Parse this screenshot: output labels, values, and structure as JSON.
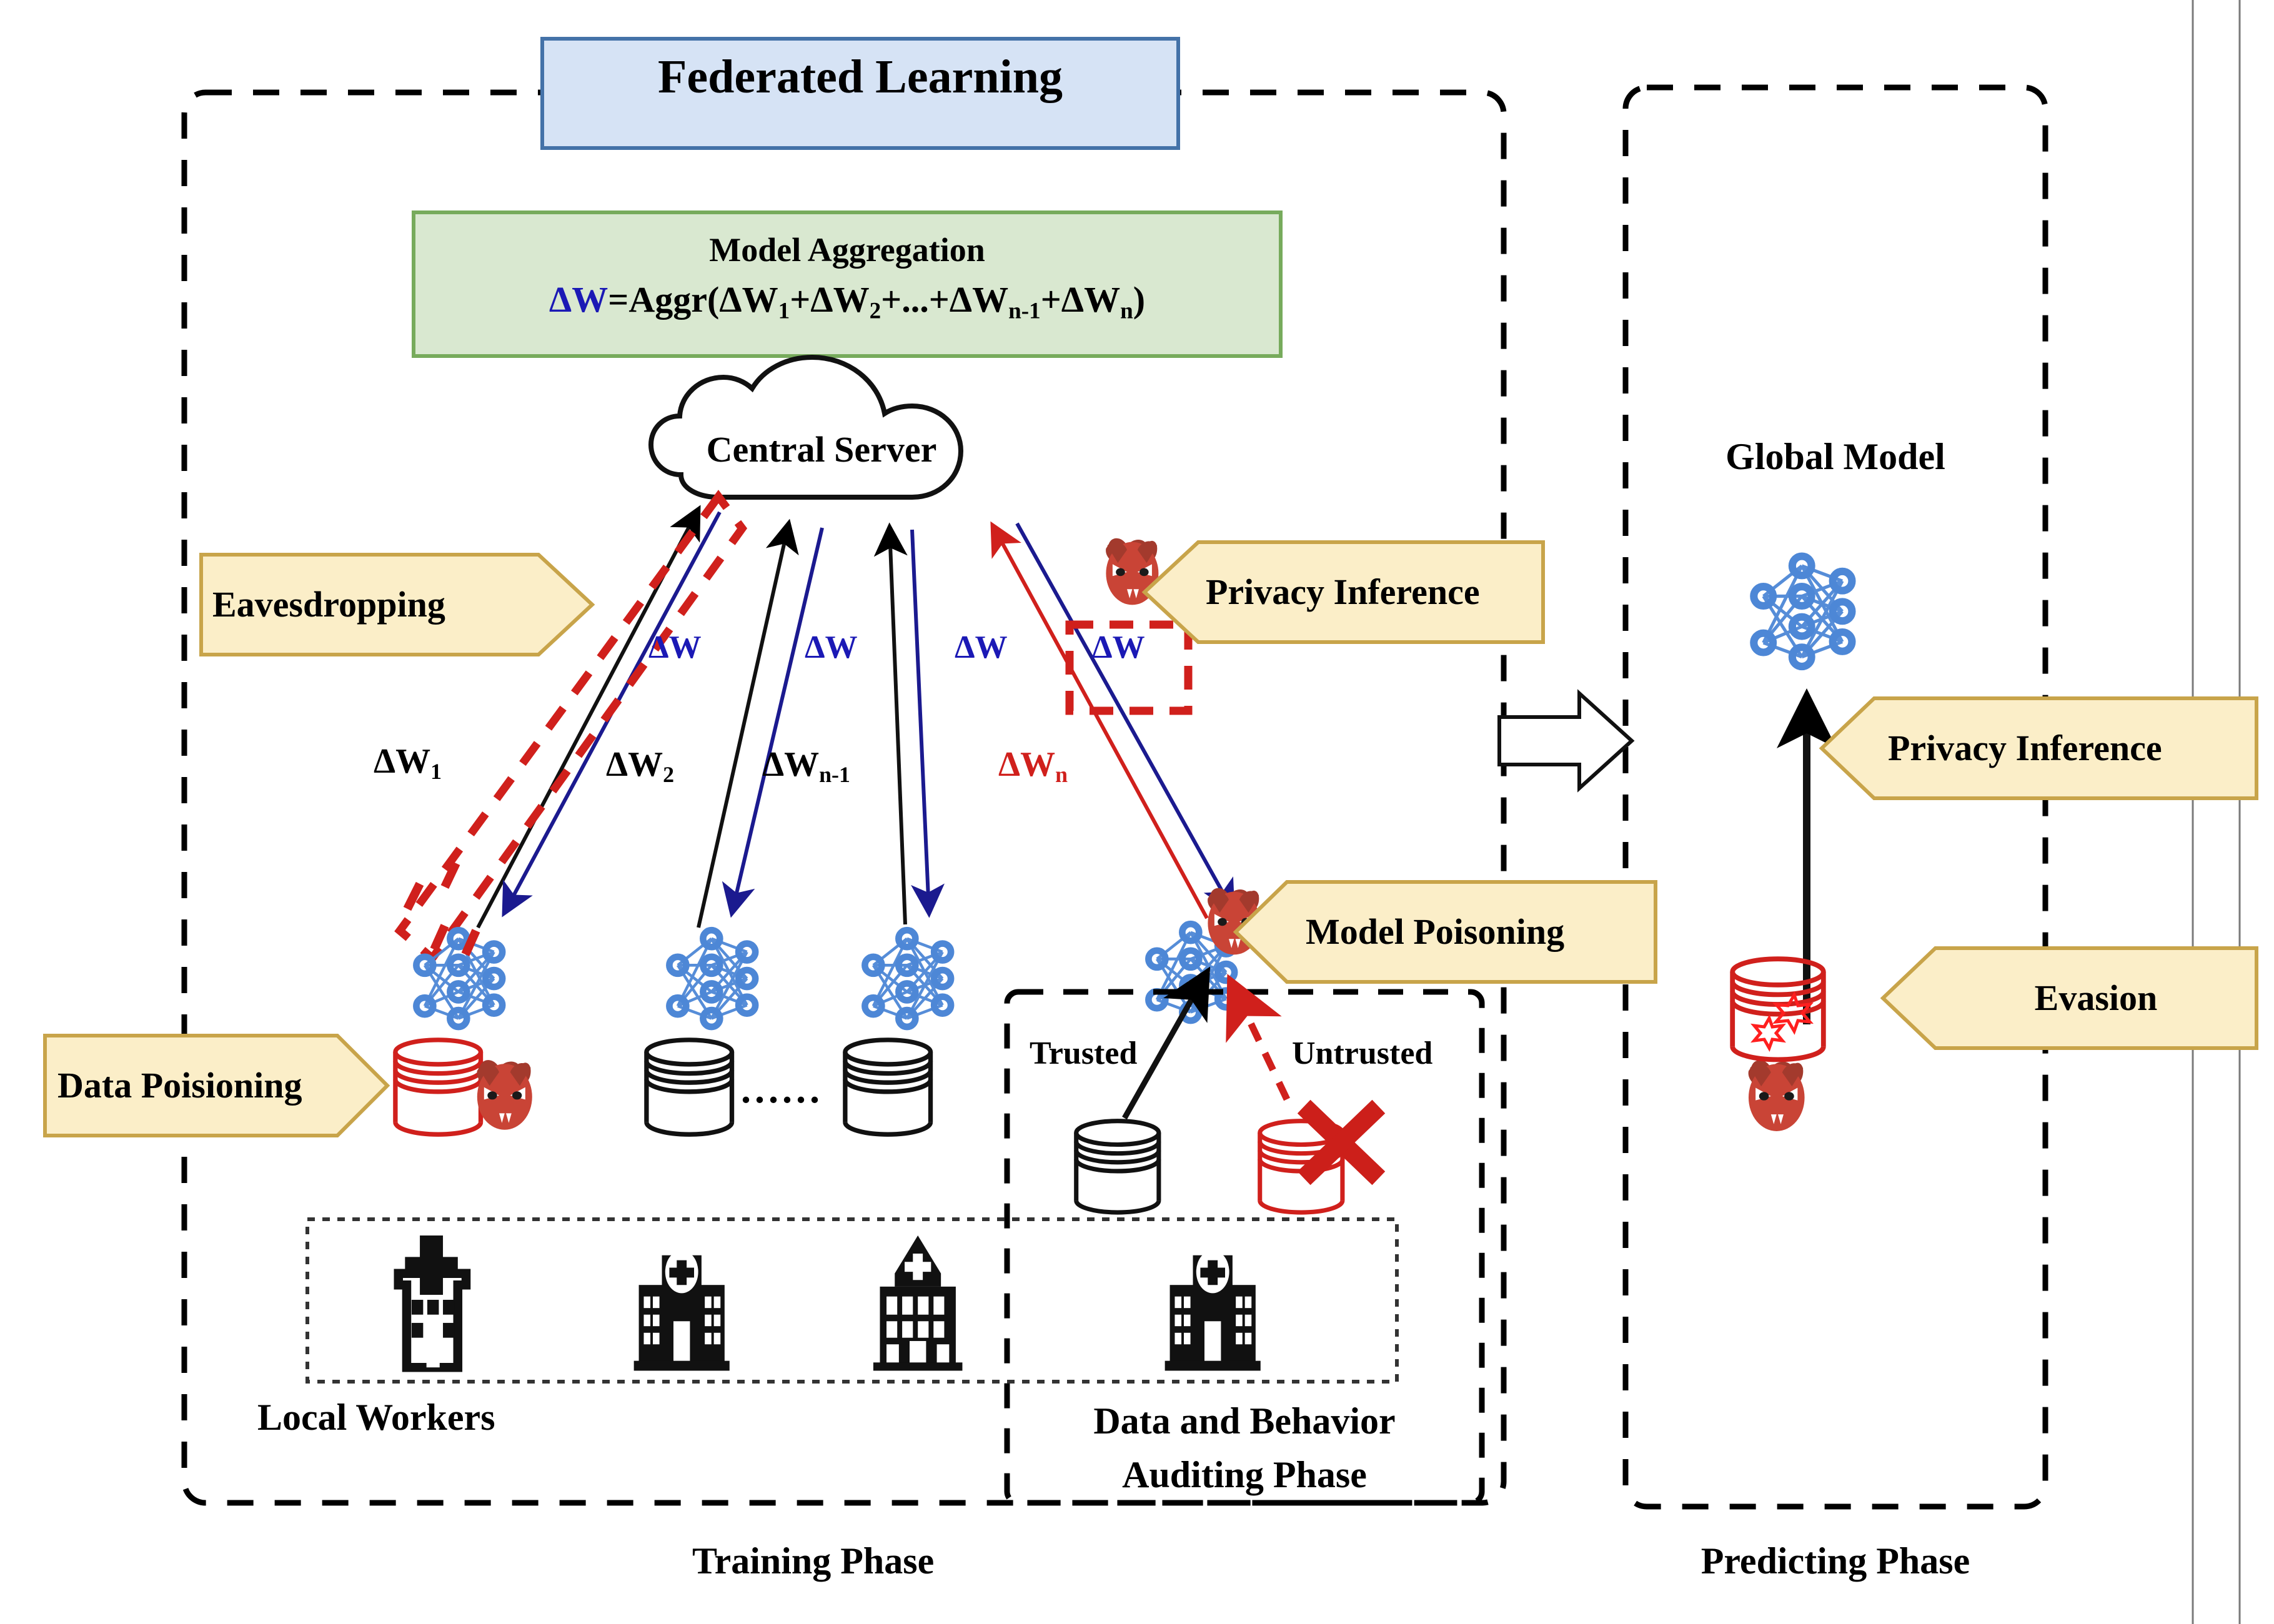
{
  "figure": {
    "kind": "federated-learning-threat-model-diagram"
  },
  "left_panel": {
    "title": "Federated Learning",
    "aggregation": {
      "heading": "Model Aggregation",
      "formula_prefix": "ΔW",
      "formula_rest": "=Aggr(ΔW",
      "t1": "1",
      "p1": "+ΔW",
      "t2": "2",
      "p2": "+...+ΔW",
      "t3": "n-1",
      "p3": "+ΔW",
      "t4": "n",
      "p4": ")"
    },
    "server_label": "Central Server",
    "download_labels": [
      "ΔW",
      "ΔW",
      "ΔW",
      "ΔW"
    ],
    "upload_labels": [
      {
        "base": "ΔW",
        "sub": "1",
        "color": "#000000"
      },
      {
        "base": "ΔW",
        "sub": "2",
        "color": "#000000"
      },
      {
        "base": "ΔW",
        "sub": "n-1",
        "color": "#000000"
      },
      {
        "base": "ΔW",
        "sub": "n",
        "color": "#d0201c"
      }
    ],
    "workers_caption": "Local Workers",
    "phase_caption": "Training Phase",
    "attacks": [
      {
        "id": "eavesdropping",
        "label": "Eavesdropping",
        "direction": "right"
      },
      {
        "id": "privacy-inference-train",
        "label": "Privacy Inference",
        "direction": "left"
      },
      {
        "id": "data-poisoning",
        "label": "Data Poisioning",
        "direction": "right"
      },
      {
        "id": "model-poisoning",
        "label": "Model Poisoning",
        "direction": "left"
      }
    ],
    "audit": {
      "trusted_label": "Trusted",
      "untrusted_label": "Untrusted",
      "caption_line1": "Data and Behavior",
      "caption_line2": "Auditing Phase"
    },
    "ellipsis": "......"
  },
  "right_panel": {
    "global_model_label": "Global Model",
    "phase_caption": "Predicting Phase",
    "attacks": [
      {
        "id": "privacy-inference-predict",
        "label": "Privacy Inference",
        "direction": "left"
      },
      {
        "id": "evasion",
        "label": "Evasion",
        "direction": "left"
      }
    ]
  },
  "colors": {
    "title_fill": "#d6e3f5",
    "title_border": "#4472a8",
    "aggregation_fill": "#d9e8d0",
    "aggregation_border": "#77ab5c",
    "banner_fill": "#fbeec8",
    "banner_border": "#c8a44a",
    "neural_blue": "#4d87d6",
    "delta_blue": "#1b19b5",
    "attack_red": "#d0201c",
    "devil_red": "#c94436",
    "black": "#000000"
  }
}
